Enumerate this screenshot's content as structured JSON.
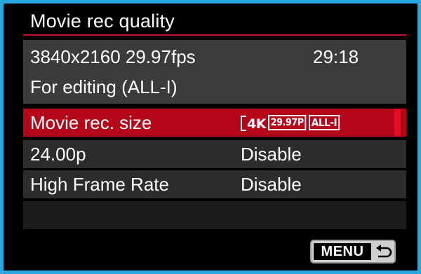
{
  "header": {
    "title": "Movie rec quality"
  },
  "info": {
    "resolution_fps": "3840x2160 29.97fps",
    "remaining_time": "29:18",
    "description": "For editing (ALL-I)"
  },
  "menu": {
    "items": [
      {
        "label": "Movie rec. size",
        "value_icon": {
          "size": "4K",
          "frame_rate": "29.97P",
          "compression": "ALL-I"
        },
        "selected": true
      },
      {
        "label": "24.00p",
        "value": "Disable",
        "selected": false
      },
      {
        "label": "High Frame Rate",
        "value": "Disable",
        "selected": false
      }
    ]
  },
  "footer": {
    "menu_button_label": "MENU",
    "back_icon": "return-arrow-icon"
  },
  "colors": {
    "frame": "#29a8e0",
    "background": "#000000",
    "panel": "#3b3b3b",
    "accent_red": "#c8102e",
    "selected_row": "#b4081a",
    "text": "#ffffff"
  }
}
